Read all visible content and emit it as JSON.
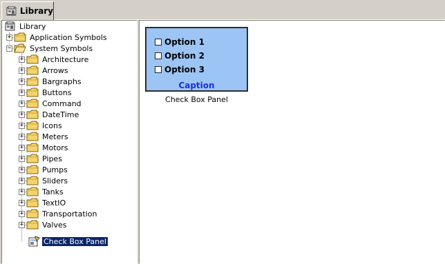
{
  "tab": {
    "label": "Library",
    "icon": "library-icon"
  },
  "tree": {
    "root": {
      "label": "Library",
      "icon": "library-icon"
    },
    "application_symbols": {
      "label": "Application Symbols",
      "expanded": false
    },
    "system_symbols": {
      "label": "System Symbols",
      "expanded": true,
      "children": [
        {
          "label": "Architecture"
        },
        {
          "label": "Arrows"
        },
        {
          "label": "Bargraphs"
        },
        {
          "label": "Buttons"
        },
        {
          "label": "Command"
        },
        {
          "label": "DateTime"
        },
        {
          "label": "Icons"
        },
        {
          "label": "Meters"
        },
        {
          "label": "Motors"
        },
        {
          "label": "Pipes"
        },
        {
          "label": "Pumps"
        },
        {
          "label": "Sliders"
        },
        {
          "label": "Tanks"
        },
        {
          "label": "TextIO"
        },
        {
          "label": "Transportation"
        },
        {
          "label": "Valves"
        }
      ]
    },
    "selected_item": {
      "label": "Check Box Panel",
      "icon": "symbol-icon"
    }
  },
  "preview": {
    "options": [
      "Option 1",
      "Option 2",
      "Option 3"
    ],
    "caption": "Caption",
    "name": "Check Box Panel",
    "colors": {
      "panel_bg": "#9cc4f4",
      "caption_text": "#1d2fd4"
    }
  },
  "colors": {
    "window_bg": "#d4d0c8",
    "selection_bg": "#0a246a",
    "folder": "#f5d36b"
  }
}
